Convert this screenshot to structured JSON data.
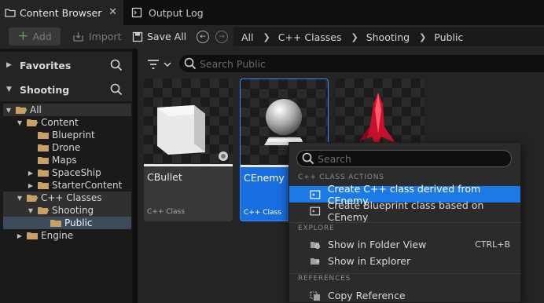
{
  "tabs": [
    {
      "label": "Content Browser",
      "icon": "folder-icon",
      "active": true
    },
    {
      "label": "Output Log",
      "icon": "log-icon",
      "active": false
    }
  ],
  "close_glyph": "✕",
  "toolbar": {
    "add_label": "Add",
    "import_label": "Import",
    "saveall_label": "Save All",
    "back_glyph": "←",
    "forward_glyph": "→"
  },
  "breadcrumb": [
    "All",
    "C++ Classes",
    "Shooting",
    "Public"
  ],
  "breadcrumb_sep": "❯",
  "sidebar": {
    "favorites_label": "Favorites",
    "project_label": "Shooting",
    "tree": [
      {
        "label": "All",
        "depth": 0,
        "expanded": true
      },
      {
        "label": "Content",
        "depth": 1,
        "expanded": true
      },
      {
        "label": "Blueprint",
        "depth": 2,
        "expanded": null
      },
      {
        "label": "Drone",
        "depth": 2,
        "expanded": null
      },
      {
        "label": "Maps",
        "depth": 2,
        "expanded": null
      },
      {
        "label": "SpaceShip",
        "depth": 2,
        "expanded": false
      },
      {
        "label": "StarterContent",
        "depth": 2,
        "expanded": false
      },
      {
        "label": "C++ Classes",
        "depth": 1,
        "expanded": true
      },
      {
        "label": "Shooting",
        "depth": 2,
        "expanded": true
      },
      {
        "label": "Public",
        "depth": 3,
        "expanded": null
      },
      {
        "label": "Engine",
        "depth": 1,
        "expanded": false
      }
    ]
  },
  "content": {
    "search_placeholder": "Search Public",
    "assets": [
      {
        "name": "CBullet",
        "type": "C++ Class",
        "thumbnail": "cube"
      },
      {
        "name": "CEnemy",
        "type": "C++ Class",
        "thumbnail": "sphere"
      },
      {
        "name": "",
        "type": "",
        "thumbnail": "red-ship"
      }
    ]
  },
  "context_menu": {
    "search_placeholder": "Search",
    "sections": [
      {
        "header": "C++ CLASS ACTIONS",
        "items": [
          {
            "label": "Create C++ class derived from CEnemy",
            "icon": "cpp-class-icon"
          },
          {
            "label": "Create Blueprint class based on CEnemy",
            "icon": "blueprint-class-icon"
          }
        ]
      },
      {
        "header": "EXPLORE",
        "items": [
          {
            "label": "Show in Folder View",
            "icon": "folder-search-icon",
            "shortcut": "CTRL+B"
          },
          {
            "label": "Show in Explorer",
            "icon": "explorer-icon"
          }
        ]
      },
      {
        "header": "REFERENCES",
        "items": [
          {
            "label": "Copy Reference",
            "icon": "copy-icon"
          }
        ]
      }
    ]
  },
  "colors": {
    "accent": "#1c7ae6",
    "selected_asset": "#1a6fe0",
    "folder": "#c8a065",
    "add_plus": "#52a83f"
  }
}
